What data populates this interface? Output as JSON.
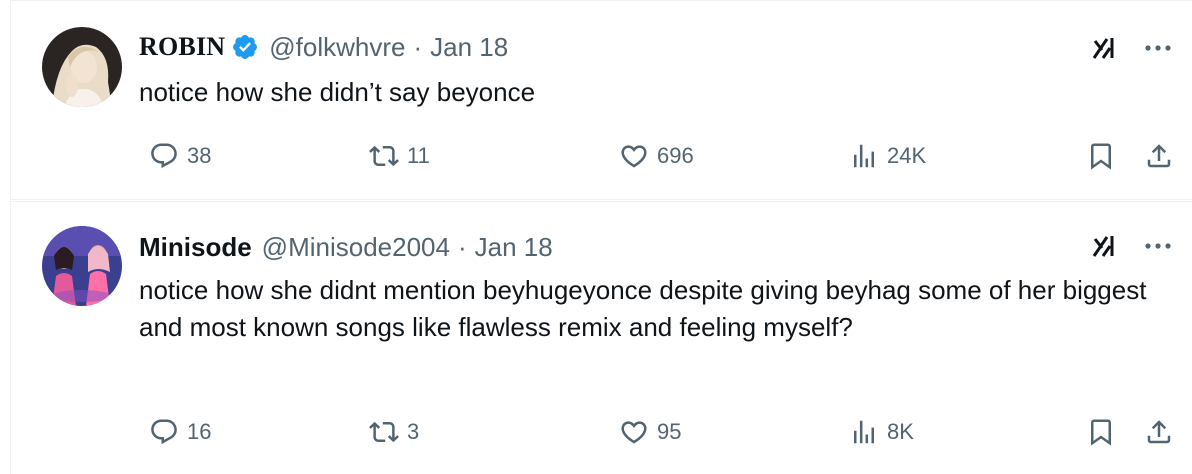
{
  "tweets": [
    {
      "name": "ROBIN",
      "verified": true,
      "handle": "@folkwhvre",
      "separator": "·",
      "date": "Jan 18",
      "text": "notice how she didn’t say beyonce",
      "replies": "38",
      "retweets": "11",
      "likes": "696",
      "views": "24K"
    },
    {
      "name": "Minisode",
      "verified": false,
      "handle": "@Minisode2004",
      "separator": "·",
      "date": "Jan 18",
      "text": "notice how she didnt mention beyhugeyonce despite giving beyhag some of her biggest and most known songs like flawless remix and feeling myself?",
      "replies": "16",
      "retweets": "3",
      "likes": "95",
      "views": "8K"
    }
  ],
  "colors": {
    "text": "#0f1419",
    "secondary": "#536471",
    "verified": "#1d9bf0",
    "border": "#eff3f4"
  },
  "icons": [
    "verified-badge-icon",
    "grok-icon",
    "more-icon",
    "reply-icon",
    "retweet-icon",
    "like-icon",
    "views-icon",
    "bookmark-icon",
    "share-icon"
  ]
}
